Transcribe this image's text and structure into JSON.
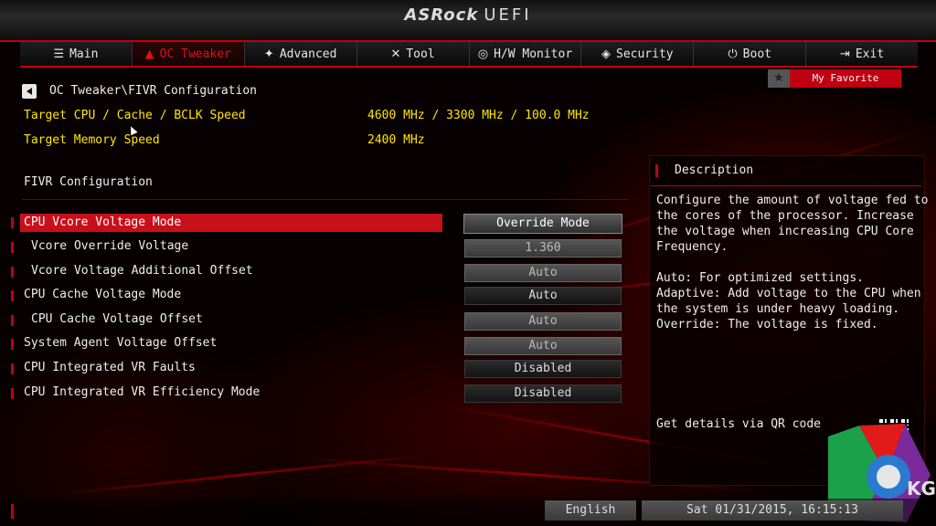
{
  "header": {
    "brand": "ASRock",
    "product": "UEFI"
  },
  "tabs": [
    {
      "label": "Main",
      "icon": "list-icon"
    },
    {
      "label": "OC Tweaker",
      "icon": "rocket-icon"
    },
    {
      "label": "Advanced",
      "icon": "star-icon"
    },
    {
      "label": "Tool",
      "icon": "tools-icon"
    },
    {
      "label": "H/W Monitor",
      "icon": "monitor-icon"
    },
    {
      "label": "Security",
      "icon": "shield-icon"
    },
    {
      "label": "Boot",
      "icon": "power-icon"
    },
    {
      "label": "Exit",
      "icon": "exit-icon"
    }
  ],
  "active_tab": "OC Tweaker",
  "favorite": {
    "label": "My Favorite"
  },
  "breadcrumb": "OC Tweaker\\FIVR Configuration",
  "info": {
    "cpu_label": "Target CPU / Cache / BCLK Speed",
    "cpu_value": "4600 MHz / 3300 MHz / 100.0 MHz",
    "mem_label": "Target Memory Speed",
    "mem_value": "2400 MHz"
  },
  "section_title": "FIVR Configuration",
  "settings": [
    {
      "label": "CPU Vcore Voltage Mode",
      "value": "Override Mode"
    },
    {
      "label": "Vcore Override Voltage",
      "value": "1.360"
    },
    {
      "label": "Vcore Voltage Additional Offset",
      "value": "Auto"
    },
    {
      "label": "CPU Cache Voltage Mode",
      "value": "Auto"
    },
    {
      "label": "CPU Cache Voltage Offset",
      "value": "Auto"
    },
    {
      "label": "System Agent Voltage Offset",
      "value": "Auto"
    },
    {
      "label": "CPU Integrated VR Faults",
      "value": "Disabled"
    },
    {
      "label": "CPU Integrated VR Efficiency Mode",
      "value": "Disabled"
    }
  ],
  "description": {
    "title": "Description",
    "text1": "Configure the amount of voltage fed to\nthe cores of the processor. Increase\nthe voltage when increasing CPU Core\nFrequency.",
    "text2": "Auto: For optimized settings.\nAdaptive: Add voltage to the CPU when\nthe system is under heavy loading.\nOverride: The voltage is fixed.",
    "qr_label": "Get details via QR code"
  },
  "footer": {
    "language": "English",
    "datetime": "Sat 01/31/2015, 16:15:13"
  },
  "watermark": "KG",
  "colors": {
    "accent": "#c00010",
    "highlight": "#ffe600"
  }
}
